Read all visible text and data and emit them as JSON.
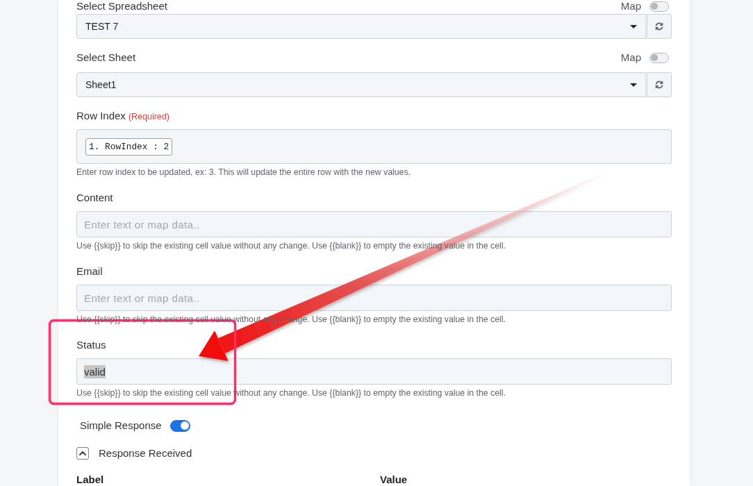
{
  "fields": [
    {
      "kind": "select",
      "label": "Select Spreadsheet",
      "map_label": "Map",
      "map_on": false,
      "value": "TEST 7"
    },
    {
      "kind": "select",
      "label": "Select Sheet",
      "map_label": "Map",
      "map_on": false,
      "value": "Sheet1"
    },
    {
      "kind": "token",
      "label": "Row Index",
      "required_note": "(Required)",
      "tokens": [
        "1. RowIndex : 2"
      ],
      "hint": "Enter row index to be updated, ex: 3. This will update the entire row with the new values."
    },
    {
      "kind": "text",
      "label": "Content",
      "placeholder": "Enter text or map data..",
      "hint": "Use {{skip}} to skip the existing cell value without any change. Use {{blank}} to empty the existing value in the cell."
    },
    {
      "kind": "text",
      "label": "Email",
      "placeholder": "Enter text or map data..",
      "hint": "Use {{skip}} to skip the existing cell value without any change. Use {{blank}} to empty the existing value in the cell."
    },
    {
      "kind": "text",
      "label": "Status",
      "value": "valid",
      "text_selected": true,
      "hint": "Use {{skip}} to skip the existing cell value without any change. Use {{blank}} to empty the existing value in the cell."
    }
  ],
  "simple_response": {
    "label": "Simple Response",
    "on": true
  },
  "response_received": {
    "label": "Response Received",
    "expanded": true
  },
  "table": {
    "columns": [
      "Label",
      "Value"
    ]
  },
  "annotations": [
    {
      "kind": "arrow"
    },
    {
      "kind": "frame"
    }
  ]
}
